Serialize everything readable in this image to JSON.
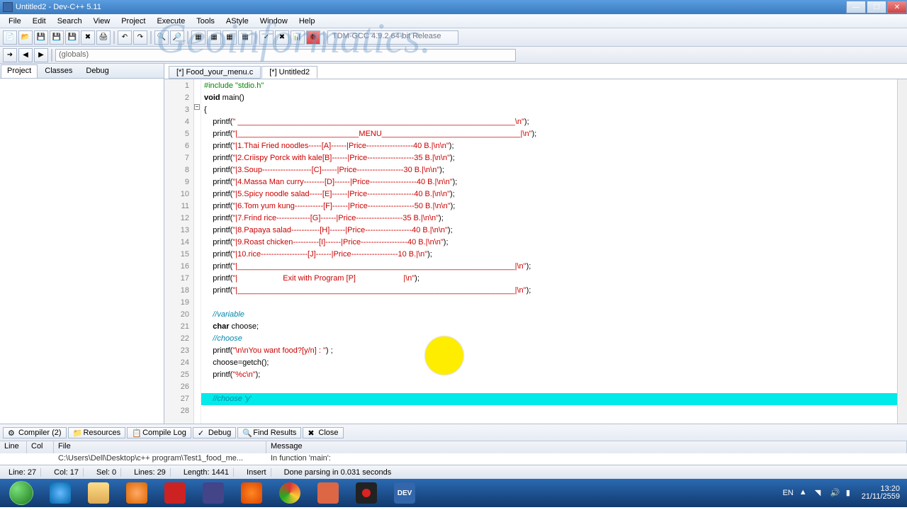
{
  "window": {
    "title": "Untitled2 - Dev-C++ 5.11"
  },
  "menubar": [
    "File",
    "Edit",
    "Search",
    "View",
    "Project",
    "Execute",
    "Tools",
    "AStyle",
    "Window",
    "Help"
  ],
  "compiler_select": "TDM-GCC 4.9.2 64-bit Release",
  "globals": "(globals)",
  "side_tabs": {
    "project": "Project",
    "classes": "Classes",
    "debug": "Debug"
  },
  "editor_tabs": {
    "tab1": "[*] Food_your_menu.c",
    "tab2": "[*] Untitled2"
  },
  "code": {
    "l1": "#include \"stdio.h\"",
    "l2a": "void",
    "l2b": " main()",
    "l3": "{",
    "l4a": "    printf(",
    "l4s": "\" ________________________________________________________________\\n\"",
    "l4b": ");",
    "l5a": "    printf(",
    "l5s": "\"|____________________________MENU________________________________|\\n\"",
    "l5b": ");",
    "l6a": "    printf(",
    "l6s": "\"|1.Thai Fried noodles-----[A]------|Price------------------40 B.|\\n\\n\"",
    "l6b": ");",
    "l7a": "    printf(",
    "l7s": "\"|2.Criispy Porck with kale[B]------|Price------------------35 B.|\\n\\n\"",
    "l7b": ");",
    "l8a": "    printf(",
    "l8s": "\"|3.Soup-------------------[C]------|Price------------------30 B.|\\n\\n\"",
    "l8b": ");",
    "l9a": "    printf(",
    "l9s": "\"|4.Massa Man curry--------[D]------|Price------------------40 B.|\\n\\n\"",
    "l9b": ");",
    "l10a": "    printf(",
    "l10s": "\"|5.Spicy noodle salad-----[E]------|Price------------------40 B.|\\n\\n\"",
    "l10b": ");",
    "l11a": "    printf(",
    "l11s": "\"|6.Tom yum kung-----------[F]------|Price------------------50 B.|\\n\\n\"",
    "l11b": ");",
    "l12a": "    printf(",
    "l12s": "\"|7.Frind rice-------------[G]------|Price------------------35 B.|\\n\\n\"",
    "l12b": ");",
    "l13a": "    printf(",
    "l13s": "\"|8.Papaya salad-----------[H]------|Price------------------40 B.|\\n\\n\"",
    "l13b": ");",
    "l14a": "    printf(",
    "l14s": "\"|9.Roast chicken----------[I]------|Price------------------40 B.|\\n\\n\"",
    "l14b": ");",
    "l15a": "    printf(",
    "l15s": "\"|10.rice------------------[J]------|Price------------------10 B.|\\n\"",
    "l15b": ");",
    "l16a": "    printf(",
    "l16s": "\"|________________________________________________________________|\\n\"",
    "l16b": ");",
    "l17a": "    printf(",
    "l17s": "\"|                     Exit with Program [P]                      |\\n\"",
    "l17b": ");",
    "l18a": "    printf(",
    "l18s": "\"|________________________________________________________________|\\n\"",
    "l18b": ");",
    "l20": "    //variable",
    "l21a": "    ",
    "l21k": "char",
    "l21b": " choose;",
    "l22": "    //choose",
    "l23a": "    printf(",
    "l23s": "\"\\n\\nYou want food?[y/n] : \"",
    "l23b": ") ;",
    "l24": "    choose=getch();",
    "l25a": "    printf(",
    "l25s": "\"%c\\n\"",
    "l25b": ");",
    "l27": "    //choose 'y'"
  },
  "bottom_tabs": {
    "compiler": "Compiler (2)",
    "resources": "Resources",
    "compilelog": "Compile Log",
    "debug": "Debug",
    "findresults": "Find Results",
    "close": "Close"
  },
  "msg_headers": {
    "line": "Line",
    "col": "Col",
    "file": "File",
    "message": "Message"
  },
  "msg_row": {
    "file": "C:\\Users\\Dell\\Desktop\\c++ program\\Test1_food_me...",
    "message": "In function 'main':"
  },
  "status": {
    "line": "Line:   27",
    "col": "Col:   17",
    "sel": "Sel:   0",
    "lines": "Lines:   29",
    "length": "Length:   1441",
    "mode": "Insert",
    "parse": "Done parsing in 0.031 seconds"
  },
  "tray": {
    "lang": "EN",
    "time": "13:20",
    "date": "21/11/2559"
  },
  "watermark": "Geoinformatics."
}
